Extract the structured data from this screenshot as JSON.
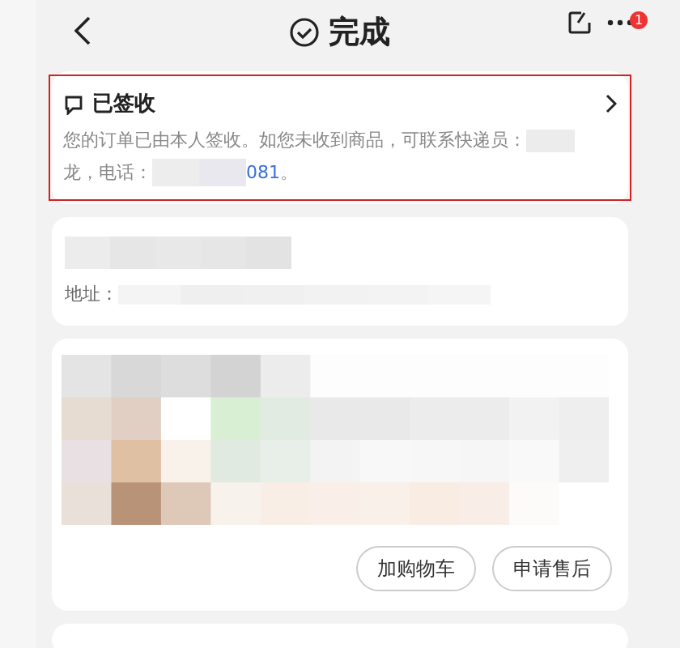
{
  "header": {
    "title": "完成",
    "badge": "1"
  },
  "status_card": {
    "title": "已签收",
    "message_start": "您的订单已由本人签收。如您未收到商品，可联系快递员：",
    "message_line2": "龙，电话：",
    "phone_end": "081",
    "message_end": "。"
  },
  "address_card": {
    "address_label": "地址："
  },
  "product_card": {
    "buttons": [
      "加购物车",
      "申请售后"
    ]
  }
}
